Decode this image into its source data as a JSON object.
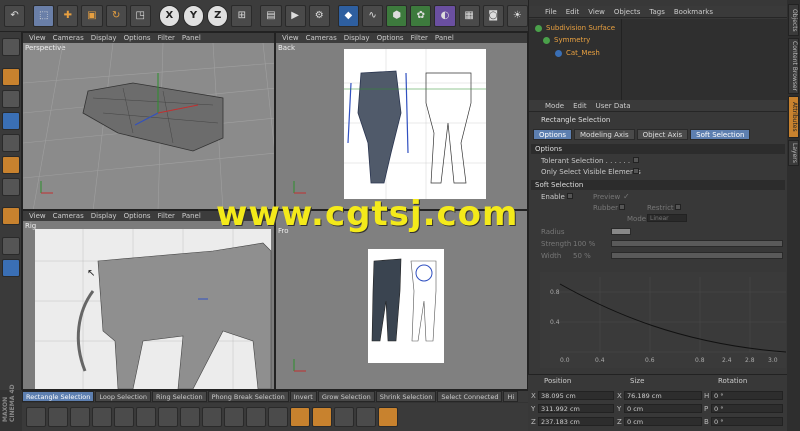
{
  "colors": {
    "accent": "#5d7fb0",
    "orange": "#c8822e",
    "watermark": "#f4ea1a"
  },
  "toolbar": {
    "icons": [
      "undo-icon",
      "select-icon",
      "move-icon",
      "scale-icon",
      "rotate-icon",
      "live-select-icon",
      "x-axis",
      "y-axis",
      "z-axis",
      "world-coord-icon",
      "render-region-icon",
      "render-view-icon",
      "render-settings-icon",
      "cube-icon",
      "spline-pen-icon",
      "subdivision-icon",
      "array-icon",
      "deformer-icon",
      "scene-icon",
      "camera-icon",
      "light-icon"
    ],
    "x": "X",
    "y": "Y",
    "z": "Z"
  },
  "viewports": {
    "perspective": {
      "name": "Perspective",
      "menu": [
        "View",
        "Cameras",
        "Display",
        "Options",
        "Filter",
        "Panel"
      ]
    },
    "back": {
      "name": "Back",
      "menu": [
        "View",
        "Cameras",
        "Display",
        "Options",
        "Filter",
        "Panel"
      ]
    },
    "right": {
      "name": "Rig",
      "menu": [
        "View",
        "Cameras",
        "Display",
        "Options",
        "Filter",
        "Panel"
      ]
    },
    "front": {
      "name": "Fro"
    }
  },
  "objects": {
    "menu": [
      "File",
      "Edit",
      "View",
      "Objects",
      "Tags",
      "Bookmarks"
    ],
    "items": [
      {
        "label": "Subdivision Surface"
      },
      {
        "label": "Symmetry"
      },
      {
        "label": "Cat_Mesh"
      }
    ]
  },
  "attributes": {
    "menu": [
      "Mode",
      "Edit",
      "User Data"
    ],
    "title": "Rectangle Selection",
    "tabs": [
      "Options",
      "Modeling Axis",
      "Object Axis",
      "Soft Selection"
    ],
    "options_section": "Options",
    "tolerant": "Tolerant Selection . . . . . . . .",
    "only_visible": "Only Select Visible Elements",
    "soft_section": "Soft Selection",
    "enable": "Enable",
    "preview": "Preview",
    "rubber": "Rubber",
    "restrict": "Restrict",
    "mode": "Mode",
    "mode_value": "Linear",
    "radius": "Radius",
    "strength": "Strength",
    "strength_value": "100 %",
    "width": "Width",
    "width_value": "50 %"
  },
  "curve": {
    "x_ticks": [
      "0.0",
      "0.4",
      "0.6",
      "0.8",
      "1.0"
    ],
    "y_ticks": [
      "0.8",
      "0.4"
    ],
    "right_ticks": [
      "2.4",
      "2.8",
      "3.0"
    ]
  },
  "coords": {
    "position_label": "Position",
    "size_label": "Size",
    "rotation_label": "Rotation",
    "rows": [
      {
        "axis": "X",
        "pos": "38.095 cm",
        "size_axis": "X",
        "size": "76.189 cm",
        "rot_axis": "H",
        "rot": "0 °"
      },
      {
        "axis": "Y",
        "pos": "311.992 cm",
        "size_axis": "Y",
        "size": "0 cm",
        "rot_axis": "P",
        "rot": "0 °"
      },
      {
        "axis": "Z",
        "pos": "237.183 cm",
        "size_axis": "Z",
        "size": "0 cm",
        "rot_axis": "B",
        "rot": "0 °"
      }
    ]
  },
  "bottom": {
    "buttons": [
      "Rectangle Selection",
      "Loop Selection",
      "Ring Selection",
      "Phong Break Selection",
      "Invert",
      "Grow Selection",
      "Shrink Selection",
      "Select Connected",
      "Hi"
    ]
  },
  "sidetabs": [
    "Objects",
    "Content Browser",
    "Attributes",
    "Layers"
  ],
  "brand": "MAXON CINEMA 4D",
  "watermark": "www.cgtsj.com"
}
